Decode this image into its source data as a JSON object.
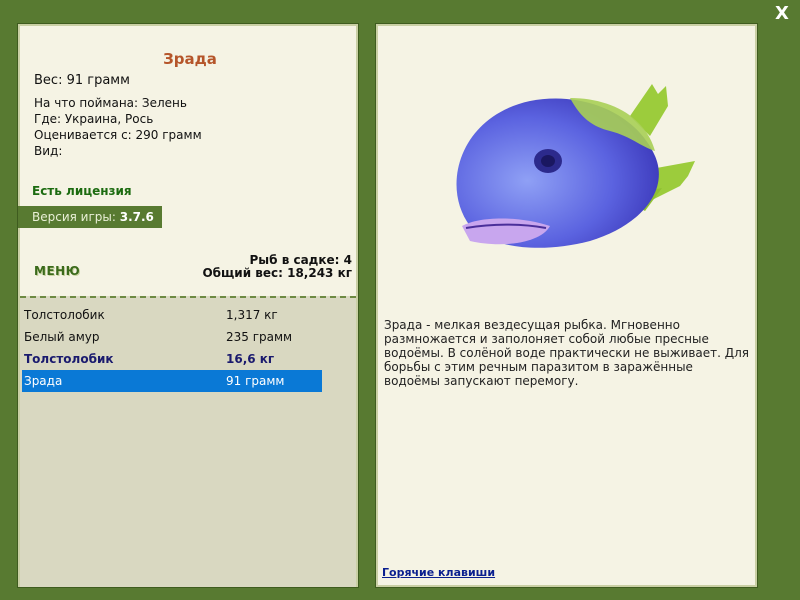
{
  "window": {
    "close_label": "X"
  },
  "fish": {
    "name": "Зрада",
    "weight": "Вес: 91 грамм",
    "caught_on": "На что поймана: Зелень",
    "location": "Где: Украина, Рось",
    "valued_from": "Оценивается с: 290 грамм",
    "species": "Вид:"
  },
  "license": "Есть лицензия",
  "version": {
    "label": "Версия игры:",
    "value": "3.7.6"
  },
  "menu_label": "МЕНЮ",
  "keep_net": {
    "count": "Рыб в садке: 4",
    "total": "Общий вес: 18,243 кг",
    "items": [
      {
        "name": "Толстолобик",
        "weight": "1,317 кг",
        "style": "normal"
      },
      {
        "name": "Белый амур",
        "weight": "235 грамм",
        "style": "normal"
      },
      {
        "name": "Толстолобик",
        "weight": "16,6 кг",
        "style": "bold"
      },
      {
        "name": "Зрада",
        "weight": "91 грамм",
        "style": "selected"
      }
    ]
  },
  "description": "Зрада - мелкая вездесущая рыбка. Мгновенно размножается и заполоняет собой любые пресные водоёмы. В солёной воде практически не выживает. Для борьбы с этим речным паразитом в заражённые водоёмы запускают перемогу.",
  "hotkeys_label": "Горячие клавиши",
  "colors": {
    "frame": "#587a31",
    "panel": "#f5f3e4",
    "fish_name": "#b5552a",
    "license": "#1c6b10",
    "selection": "#0a79d6",
    "fish_body": "#5b63e0",
    "fish_fin": "#9ccc3c"
  }
}
